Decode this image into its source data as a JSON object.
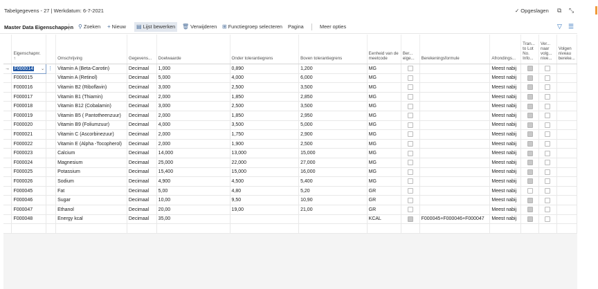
{
  "header": {
    "title": "Tabelgegevens - 27 | Werkdatum: 6-7-2021",
    "saved": "Opgeslagen"
  },
  "actions": {
    "page_title": "Master Data Eigenschappen",
    "search": "Zoeken",
    "new": "Nieuw",
    "edit_list": "Lijst bewerken",
    "delete": "Verwijderen",
    "select_function_group": "Functiegroep selecteren",
    "page": "Pagina",
    "more": "Meer opties"
  },
  "columns": {
    "code": "Eigenschapnr.",
    "sort": "↑",
    "description": "Omschrijving",
    "data_type": "Gegevens...",
    "target": "Doelwaarde",
    "lower": "Onder tolerantiegrens",
    "upper": "Boven tolerantiegrens",
    "unit": "Eenheid van de meetcode",
    "calc_flag": "Ber... eige...",
    "formula": "Berekeningsformule",
    "rounding": "Afrondings...",
    "transfer": "Tran... to Lot No. Info...",
    "next_level": "Ver... naar volg... nive...",
    "following": "Volgen niveau bereke..."
  },
  "rows": [
    {
      "code": "F000014",
      "desc": "Vitamin A (Beta-Carotin)",
      "type": "Decimaal",
      "target": "1,000",
      "lower": "0,890",
      "upper": "1,200",
      "unit": "MG",
      "calc": false,
      "formula": "",
      "round": "Meest nabij",
      "transfer": true,
      "next": false
    },
    {
      "code": "F000015",
      "desc": "Vitamin A (Retinol)",
      "type": "Decimaal",
      "target": "5,000",
      "lower": "4,000",
      "upper": "6,000",
      "unit": "MG",
      "calc": false,
      "formula": "",
      "round": "Meest nabij",
      "transfer": true,
      "next": false
    },
    {
      "code": "F000016",
      "desc": "Vitamin B2 (Riboflavin)",
      "type": "Decimaal",
      "target": "3,000",
      "lower": "2,500",
      "upper": "3,500",
      "unit": "MG",
      "calc": false,
      "formula": "",
      "round": "Meest nabij",
      "transfer": true,
      "next": false
    },
    {
      "code": "F000017",
      "desc": "Vitamin B1 (Thiamin)",
      "type": "Decimaal",
      "target": "2,000",
      "lower": "1,850",
      "upper": "2,850",
      "unit": "MG",
      "calc": false,
      "formula": "",
      "round": "Meest nabij",
      "transfer": true,
      "next": false
    },
    {
      "code": "F000018",
      "desc": "Vitamin B12 (Cobalamin)",
      "type": "Decimaal",
      "target": "3,000",
      "lower": "2,500",
      "upper": "3,500",
      "unit": "MG",
      "calc": false,
      "formula": "",
      "round": "Meest nabij",
      "transfer": true,
      "next": false
    },
    {
      "code": "F000019",
      "desc": "Vitamin B5 ( Pantotheenzuur)",
      "type": "Decimaal",
      "target": "2,000",
      "lower": "1,850",
      "upper": "2,950",
      "unit": "MG",
      "calc": false,
      "formula": "",
      "round": "Meest nabij",
      "transfer": true,
      "next": false
    },
    {
      "code": "F000020",
      "desc": "Vitamin B9 (Foliumzuur)",
      "type": "Decimaal",
      "target": "4,000",
      "lower": "3,500",
      "upper": "5,000",
      "unit": "MG",
      "calc": false,
      "formula": "",
      "round": "Meest nabij",
      "transfer": true,
      "next": false
    },
    {
      "code": "F000021",
      "desc": "Vitamin C (Ascorbinezuur)",
      "type": "Decimaal",
      "target": "2,000",
      "lower": "1,750",
      "upper": "2,900",
      "unit": "MG",
      "calc": false,
      "formula": "",
      "round": "Meest nabij",
      "transfer": true,
      "next": false
    },
    {
      "code": "F000022",
      "desc": "Vitamin E (Alpha -Tocopherol)",
      "type": "Decimaal",
      "target": "2,000",
      "lower": "1,900",
      "upper": "2,500",
      "unit": "MG",
      "calc": false,
      "formula": "",
      "round": "Meest nabij",
      "transfer": true,
      "next": false
    },
    {
      "code": "F000023",
      "desc": "Calcium",
      "type": "Decimaal",
      "target": "14,000",
      "lower": "13,000",
      "upper": "15,000",
      "unit": "MG",
      "calc": false,
      "formula": "",
      "round": "Meest nabij",
      "transfer": true,
      "next": false
    },
    {
      "code": "F000024",
      "desc": "Magnesium",
      "type": "Decimaal",
      "target": "25,000",
      "lower": "22,000",
      "upper": "27,000",
      "unit": "MG",
      "calc": false,
      "formula": "",
      "round": "Meest nabij",
      "transfer": true,
      "next": false
    },
    {
      "code": "F000025",
      "desc": "Potassium",
      "type": "Decimaal",
      "target": "15,400",
      "lower": "15,000",
      "upper": "16,000",
      "unit": "MG",
      "calc": false,
      "formula": "",
      "round": "Meest nabij",
      "transfer": true,
      "next": false
    },
    {
      "code": "F000026",
      "desc": "Sodium",
      "type": "Decimaal",
      "target": "4,900",
      "lower": "4,500",
      "upper": "5,400",
      "unit": "MG",
      "calc": false,
      "formula": "",
      "round": "Meest nabij",
      "transfer": true,
      "next": false
    },
    {
      "code": "F000045",
      "desc": "Fat",
      "type": "Decimaal",
      "target": "5,00",
      "lower": "4,80",
      "upper": "5,20",
      "unit": "GR",
      "calc": false,
      "formula": "",
      "round": "Meest nabij",
      "transfer": false,
      "next": false
    },
    {
      "code": "F000046",
      "desc": "Sugar",
      "type": "Decimaal",
      "target": "10,00",
      "lower": "9,50",
      "upper": "10,90",
      "unit": "GR",
      "calc": false,
      "formula": "",
      "round": "Meest nabij",
      "transfer": true,
      "next": false
    },
    {
      "code": "F000047",
      "desc": "Ethanol",
      "type": "Decimaal",
      "target": "20,00",
      "lower": "19,00",
      "upper": "21,00",
      "unit": "GR",
      "calc": false,
      "formula": "",
      "round": "Meest nabij",
      "transfer": true,
      "next": false
    },
    {
      "code": "F000048",
      "desc": "Energy kcal",
      "type": "Decimaal",
      "target": "35,00",
      "lower": "",
      "upper": "",
      "unit": "KCAL",
      "calc": true,
      "formula": "F000045+F000046+F000047",
      "round": "Meest nabij",
      "transfer": true,
      "next": false
    }
  ]
}
